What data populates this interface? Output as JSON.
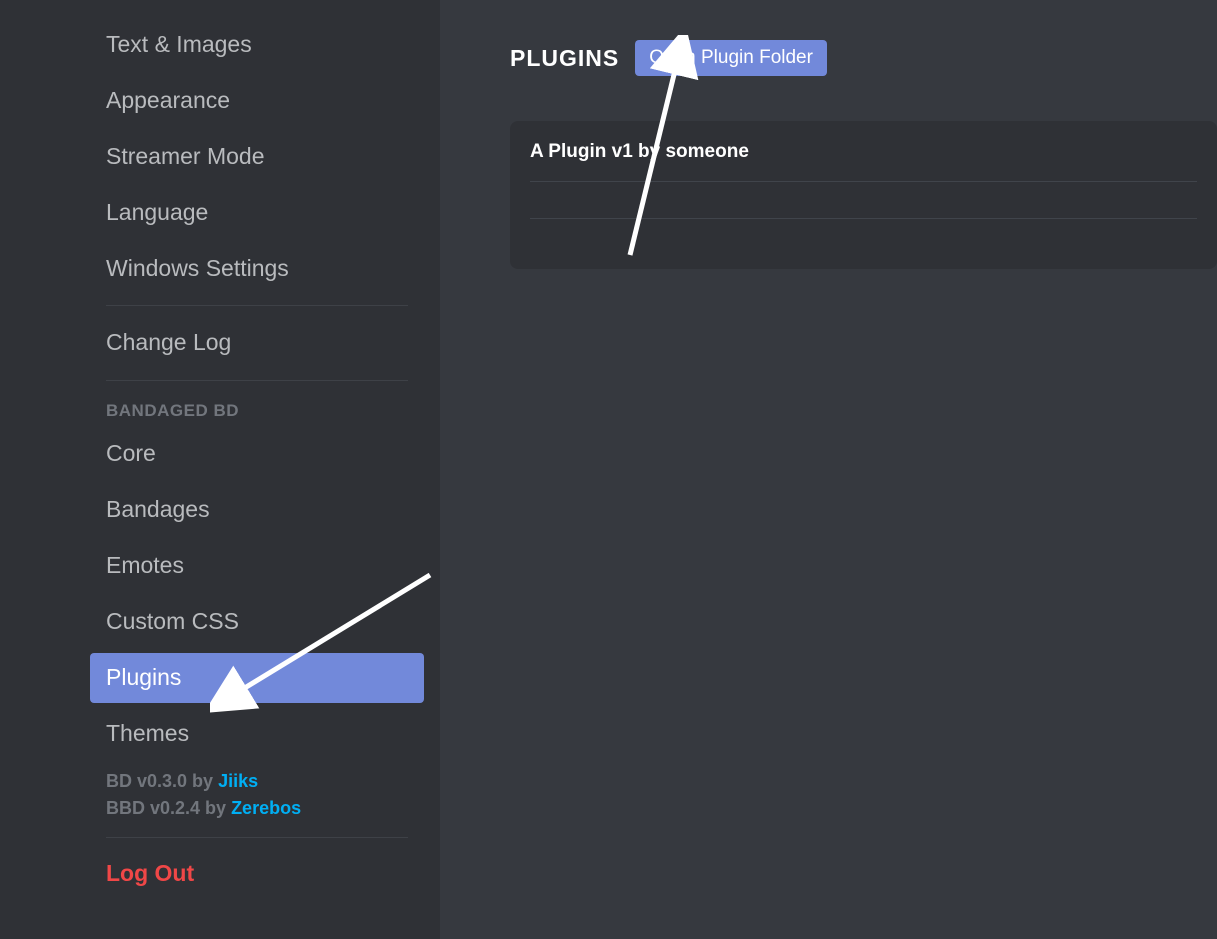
{
  "sidebar": {
    "items": {
      "textImages": "Text & Images",
      "appearance": "Appearance",
      "streamerMode": "Streamer Mode",
      "language": "Language",
      "windowsSettings": "Windows Settings",
      "changeLog": "Change Log"
    },
    "sectionHeader": "BANDAGED BD",
    "bdItems": {
      "core": "Core",
      "bandages": "Bandages",
      "emotes": "Emotes",
      "customCss": "Custom CSS",
      "plugins": "Plugins",
      "themes": "Themes"
    },
    "versions": {
      "bd": {
        "prefix": "BD v0.3.0 by ",
        "author": "Jiiks"
      },
      "bbd": {
        "prefix": "BBD v0.2.4 by ",
        "author": "Zerebos"
      }
    },
    "logout": "Log Out"
  },
  "main": {
    "title": "PLUGINS",
    "openFolderButton": "Open Plugin Folder",
    "pluginCard": {
      "title": "A Plugin v1 by someone"
    }
  }
}
